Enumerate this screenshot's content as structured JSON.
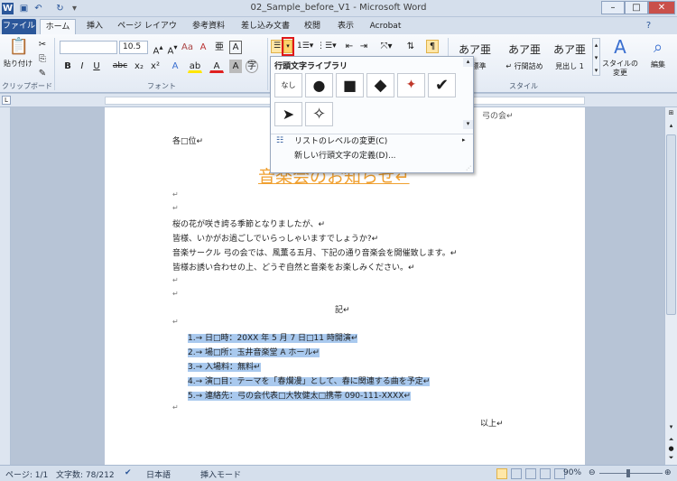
{
  "window": {
    "title": "02_Sample_before_V1 - Microsoft Word",
    "minimize": "–",
    "maximize": "□",
    "close": "✕"
  },
  "tabs": [
    "ファイル",
    "ホーム",
    "挿入",
    "ページ レイアウト",
    "参考資料",
    "差し込み文書",
    "校閲",
    "表示",
    "Acrobat"
  ],
  "ribbon": {
    "paste_label": "貼り付け",
    "font_name": "",
    "font_size": "10.5",
    "bold": "B",
    "italic": "I",
    "underline": "U",
    "strike": "abc",
    "subscript": "x₂",
    "superscript": "x²",
    "styles": [
      {
        "sample": "あア亜",
        "label": "↵ 標準"
      },
      {
        "sample": "あア亜",
        "label": "↵ 行間詰め"
      },
      {
        "sample": "あア亜",
        "label": "見出し 1"
      }
    ],
    "change_styles": "スタイルの\n変更",
    "edit": "編集",
    "groups": {
      "clipboard": "クリップボード",
      "font": "フォント",
      "styles": "スタイル"
    }
  },
  "dropdown": {
    "header": "行頭文字ライブラリ",
    "bullets": [
      {
        "label": "なし",
        "glyph": "なし"
      },
      {
        "label": "black-circle",
        "glyph": "●"
      },
      {
        "label": "black-square",
        "glyph": "■"
      },
      {
        "label": "black-diamond",
        "glyph": "◆"
      },
      {
        "label": "four-diamond",
        "glyph": "✦"
      },
      {
        "label": "checkmark",
        "glyph": "✔"
      },
      {
        "label": "arrowhead",
        "glyph": "➤"
      },
      {
        "label": "star",
        "glyph": "✧"
      }
    ],
    "menu": [
      "リストのレベルの変更(C)",
      "新しい行頭文字の定義(D)..."
    ]
  },
  "document": {
    "peek_right": "弓の会↵",
    "addressee": "各□位↵",
    "title": "音楽会のお知らせ↵",
    "body": [
      "桜の花が咲き誇る季節となりましたが、↵",
      "皆様、いかがお過ごしでいらっしゃいますでしょうか?↵",
      "音楽サークル 弓の会では、風薫る五月、下記の通り音楽会を開催致します。↵",
      "皆様お誘い合わせの上、どうぞ自然と音楽をお楽しみください。↵"
    ],
    "ki": "記↵",
    "list": [
      "1.→ 日□時：20XX 年 5 月 7 日□11 時開演↵",
      "2.→ 場□所：玉井音楽堂 A ホール↵",
      "3.→ 入場料：無料↵",
      "4.→ 演□目：テーマを「春爛漫」として、春に関連する曲を予定↵",
      "5.→ 連絡先：弓の会代表□大牧健太□携帯 090-111-XXXX↵"
    ],
    "ijo": "以上↵",
    "para_mark": "↵"
  },
  "status": {
    "page": "ページ: 1/1",
    "words": "文字数: 78/212",
    "language": "日本語",
    "mode": "挿入モード",
    "zoom": "90%"
  },
  "colors": {
    "accent": "#2b579a",
    "title": "#f0a030",
    "highlight": "#a9c9ee",
    "callout": "#e01818"
  }
}
